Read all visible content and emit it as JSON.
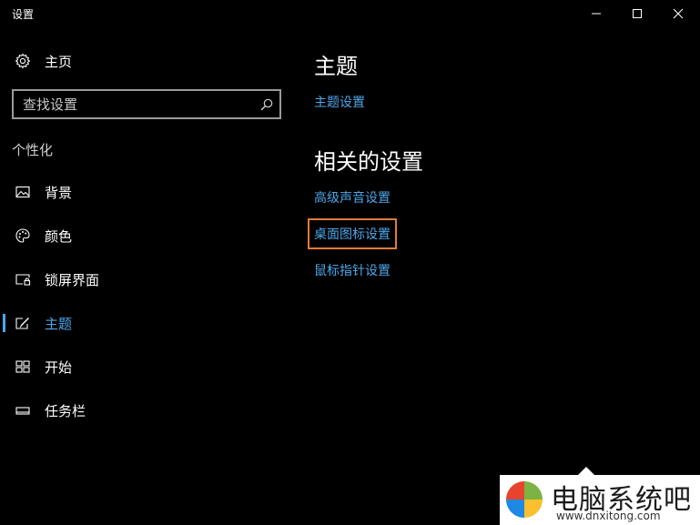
{
  "window": {
    "title": "设置"
  },
  "sidebar": {
    "home_label": "主页",
    "search_placeholder": "查找设置",
    "section_label": "个性化",
    "items": [
      {
        "label": "背景",
        "icon": "picture-icon"
      },
      {
        "label": "颜色",
        "icon": "palette-icon"
      },
      {
        "label": "锁屏界面",
        "icon": "lock-screen-icon"
      },
      {
        "label": "主题",
        "icon": "theme-brush-icon",
        "active": true
      },
      {
        "label": "开始",
        "icon": "start-tiles-icon"
      },
      {
        "label": "任务栏",
        "icon": "taskbar-icon"
      }
    ]
  },
  "main": {
    "heading": "主题",
    "theme_settings_link": "主题设置",
    "related_heading": "相关的设置",
    "links": [
      {
        "label": "高级声音设置"
      },
      {
        "label": "桌面图标设置",
        "highlighted": true
      },
      {
        "label": "鼠标指针设置"
      }
    ]
  },
  "watermark": {
    "name": "电脑系统吧",
    "url": "www.dnxitong.com"
  },
  "colors": {
    "background": "#000000",
    "accent": "#4ea6ea",
    "highlight_outline": "#e07b39",
    "text": "#ffffff"
  }
}
